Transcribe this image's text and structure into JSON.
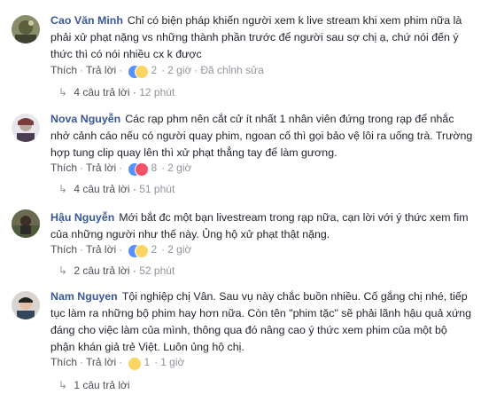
{
  "comments": [
    {
      "author": "Cao Văn Minh",
      "text": "Chỉ có biện pháp khiến người xem k live stream khi xem phim nữa là phải xử phạt nặng vs những thành phần trước để người sau sợ chị ạ, chứ nói đến ý thức thì có nói nhiều cx k được",
      "like": "Thích",
      "reply": "Trả lời",
      "reaction_icons": [
        "like-reaction-icon",
        "wow-reaction-icon"
      ],
      "reaction_count": "2",
      "time": "2 giờ",
      "edited": "Đã chỉnh sửa",
      "replies_label": "4 câu trả lời",
      "replies_time": "12 phút"
    },
    {
      "author": "Nova Nguyễn",
      "text": "Các rạp phm nên cắt cử ít nhất 1 nhân viên đứng trong rạp để nhắc nhở cảnh cáo nếu có người quay phim, ngoan cố thì gọi bảo vệ lôi ra uống trà. Trường hợp tung clip quay lên thì xử phạt thẳng tay để làm gương.",
      "like": "Thích",
      "reply": "Trả lời",
      "reaction_icons": [
        "like-reaction-icon",
        "love-reaction-icon"
      ],
      "reaction_count": "8",
      "time": "2 giờ",
      "replies_label": "4 câu trả lời",
      "replies_time": "51 phút"
    },
    {
      "author": "Hậu Nguyễn",
      "text": "Mới bắt đc một bạn livestream trong rạp nữa, cạn lời với ý thức xem fim của những người như thế này. Ủng hộ xử phạt thật nặng.",
      "like": "Thích",
      "reply": "Trả lời",
      "reaction_icons": [
        "like-reaction-icon",
        "haha-reaction-icon"
      ],
      "reaction_count": "2",
      "time": "2 giờ",
      "replies_label": "2 câu trả lời",
      "replies_time": "52 phút"
    },
    {
      "author": "Nam Nguyen",
      "text": "Tội nghiệp chị Vân. Sau vụ này chắc buồn nhiều. Cố gắng chị nhé, tiếp tục làm ra những bộ phim hay hơn nữa. Còn tên \"phim tặc\" sẽ phải lãnh hậu quả xứng đáng cho việc làm của mình, thông qua đó nâng cao ý thức xem phim của một bộ phận khán giả trẻ Việt. Luôn ủng hộ chị.",
      "like": "Thích",
      "reply": "Trả lời",
      "reaction_icons": [
        "wow-reaction-icon"
      ],
      "reaction_count": "1",
      "time": "1 giờ",
      "replies_label": "1 câu trả lời",
      "replies_time": ""
    }
  ],
  "colors": {
    "author": "#385898",
    "text": "#1d2129",
    "meta": "#90949c",
    "link": "#4b4f56",
    "like": "#5890ff",
    "love": "#f25268",
    "wow": "#fdd464"
  }
}
